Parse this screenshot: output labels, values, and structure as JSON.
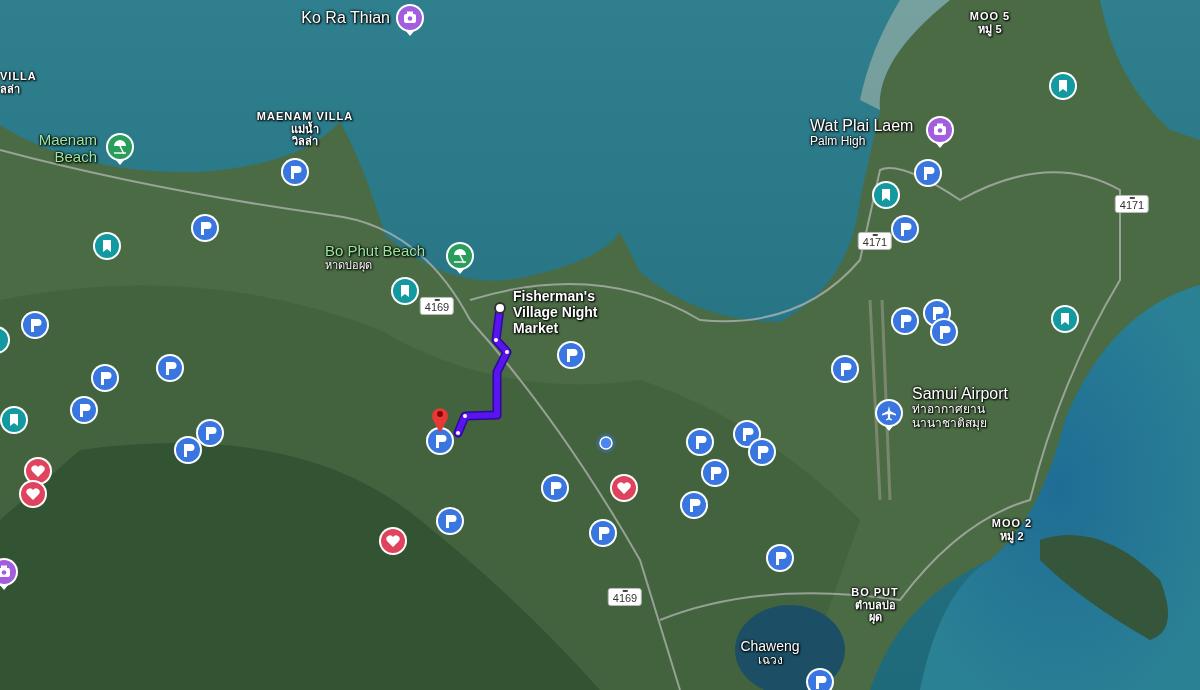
{
  "map": {
    "places": [
      {
        "kind": "poi",
        "name": "Ko Ra Thian"
      },
      {
        "kind": "area",
        "name": "VILLA",
        "local_name": "ลล่า"
      },
      {
        "kind": "area",
        "name": "MAENAM VILLA",
        "local_name": "แม่น้ำ วิลล่า"
      },
      {
        "kind": "beach",
        "name": "Maenam Beach"
      },
      {
        "kind": "beach",
        "name": "Bo Phut Beach",
        "local_name": "หาดบ่อผุด"
      },
      {
        "kind": "destination",
        "name": "Fisherman's Village Night Market"
      },
      {
        "kind": "poi",
        "name": "Wat Plai Laem",
        "local_name": "Palm High"
      },
      {
        "kind": "area",
        "name": "MOO 5",
        "local_name": "หมู่ 5"
      },
      {
        "kind": "poi",
        "name": "Samui Airport",
        "local_name": "ท่าอากาศยานนานาชาติสมุย"
      },
      {
        "kind": "area",
        "name": "MOO 2",
        "local_name": "หมู่ 2"
      },
      {
        "kind": "area",
        "name": "BO PUT",
        "local_name": "ตำบลบ่อผุด"
      },
      {
        "kind": "water",
        "name": "Chaweng",
        "local_name": "เฉวง"
      }
    ],
    "road_shields": [
      "4169",
      "4171",
      "4171",
      "4169"
    ],
    "markers": [
      {
        "kind": "camera"
      },
      {
        "kind": "camera"
      },
      {
        "kind": "camera"
      },
      {
        "kind": "beach"
      },
      {
        "kind": "beach"
      },
      {
        "kind": "bookmark"
      },
      {
        "kind": "bookmark"
      },
      {
        "kind": "bookmark"
      },
      {
        "kind": "bookmark"
      },
      {
        "kind": "bookmark"
      },
      {
        "kind": "bookmark"
      },
      {
        "kind": "bookmark"
      },
      {
        "kind": "parking"
      },
      {
        "kind": "parking"
      },
      {
        "kind": "parking"
      },
      {
        "kind": "parking"
      },
      {
        "kind": "parking"
      },
      {
        "kind": "parking"
      },
      {
        "kind": "parking"
      },
      {
        "kind": "parking"
      },
      {
        "kind": "parking"
      },
      {
        "kind": "parking"
      },
      {
        "kind": "parking"
      },
      {
        "kind": "parking"
      },
      {
        "kind": "parking"
      },
      {
        "kind": "parking"
      },
      {
        "kind": "parking"
      },
      {
        "kind": "parking"
      },
      {
        "kind": "parking"
      },
      {
        "kind": "parking"
      },
      {
        "kind": "parking"
      },
      {
        "kind": "parking"
      },
      {
        "kind": "parking"
      },
      {
        "kind": "parking"
      },
      {
        "kind": "parking"
      },
      {
        "kind": "parking"
      },
      {
        "kind": "parking"
      },
      {
        "kind": "parking"
      },
      {
        "kind": "heart"
      },
      {
        "kind": "heart"
      },
      {
        "kind": "heart"
      },
      {
        "kind": "heart"
      },
      {
        "kind": "airport"
      }
    ]
  }
}
